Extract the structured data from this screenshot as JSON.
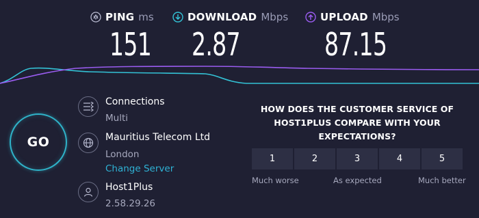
{
  "metrics": {
    "ping": {
      "label": "PING",
      "unit": "ms",
      "value": "151",
      "icon": "ping-icon"
    },
    "download": {
      "label": "DOWNLOAD",
      "unit": "Mbps",
      "value": "2.87",
      "icon": "download-arrow-icon"
    },
    "upload": {
      "label": "UPLOAD",
      "unit": "Mbps",
      "value": "87.15",
      "icon": "upload-arrow-icon"
    }
  },
  "go_label": "GO",
  "connections": {
    "title": "Connections",
    "value": "Multi",
    "icon": "connections-icon"
  },
  "provider": {
    "name": "Mauritius Telecom Ltd",
    "location": "London",
    "change_server": "Change Server",
    "icon": "globe-icon"
  },
  "host": {
    "name": "Host1Plus",
    "ip": "2.58.29.26",
    "icon": "user-icon"
  },
  "survey": {
    "question": "HOW DOES THE CUSTOMER SERVICE OF HOST1PLUS COMPARE WITH YOUR EXPECTATIONS?",
    "options": [
      "1",
      "2",
      "3",
      "4",
      "5"
    ],
    "scale_low": "Much worse",
    "scale_mid": "As expected",
    "scale_high": "Much better"
  },
  "colors": {
    "background": "#1f2033",
    "download_accent": "#33c2d6",
    "upload_accent": "#9a5cf0",
    "go_ring": "#2fb3c9",
    "link": "#2fb3d6",
    "rating_button": "#2d2f44"
  }
}
